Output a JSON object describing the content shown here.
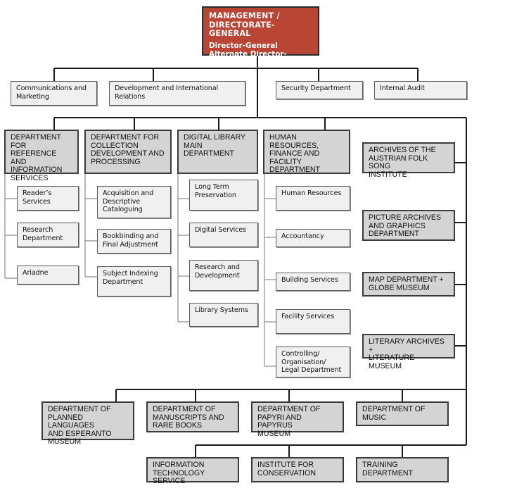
{
  "colors": {
    "management_fill": "#b94535",
    "department_fill": "#d4d4d4",
    "unit_fill": "#f0f0f0",
    "line": "#1a1a1a"
  },
  "management": {
    "title_lines": [
      "MANAGEMENT /",
      "DIRECTORATE-GENERAL"
    ],
    "roles": [
      "Director-General",
      "Alternate Director-General"
    ]
  },
  "staff_units": [
    {
      "label_lines": [
        "Communications and",
        "Marketing"
      ]
    },
    {
      "label_lines": [
        "Development and International",
        "Relations"
      ]
    },
    {
      "label_lines": [
        "Security Department"
      ]
    },
    {
      "label_lines": [
        "Internal Audit"
      ]
    }
  ],
  "main_departments": [
    {
      "label_lines": [
        "DEPARTMENT FOR",
        "REFERENCE AND",
        "INFORMATION",
        "SERVICES"
      ],
      "units": [
        {
          "label_lines": [
            "Reader’s",
            "Services"
          ]
        },
        {
          "label_lines": [
            "Research",
            "Department"
          ]
        },
        {
          "label_lines": [
            "Ariadne"
          ]
        }
      ]
    },
    {
      "label_lines": [
        "DEPARTMENT FOR",
        "COLLECTION",
        "DEVELOPMENT AND",
        "PROCESSING"
      ],
      "units": [
        {
          "label_lines": [
            "Acquisition and",
            "Descriptive",
            "Cataloguing"
          ]
        },
        {
          "label_lines": [
            "Bookbinding and",
            "Final Adjustment"
          ]
        },
        {
          "label_lines": [
            "Subject Indexing",
            "Department"
          ]
        }
      ]
    },
    {
      "label_lines": [
        "DIGITAL LIBRARY",
        "MAIN DEPARTMENT"
      ],
      "units": [
        {
          "label_lines": [
            "Long Term",
            "Preservation"
          ]
        },
        {
          "label_lines": [
            "Digital Services"
          ]
        },
        {
          "label_lines": [
            "Research and",
            "Development"
          ]
        },
        {
          "label_lines": [
            "Library Systems"
          ]
        }
      ]
    },
    {
      "label_lines": [
        "HUMAN RESOURCES,",
        "FINANCE AND",
        "FACILITY",
        "DEPARTMENT"
      ],
      "units": [
        {
          "label_lines": [
            "Human Resources"
          ]
        },
        {
          "label_lines": [
            "Accountancy"
          ]
        },
        {
          "label_lines": [
            "Building Services"
          ]
        },
        {
          "label_lines": [
            "Facility Services"
          ]
        },
        {
          "label_lines": [
            "Controlling/",
            "Organisation/",
            "Legal Department"
          ]
        }
      ]
    }
  ],
  "collection_departments": [
    {
      "label_lines": [
        "ARCHIVES OF THE",
        "AUSTRIAN FOLK SONG",
        "INSTITUTE"
      ]
    },
    {
      "label_lines": [
        "PICTURE ARCHIVES",
        "AND GRAPHICS",
        "DEPARTMENT"
      ]
    },
    {
      "label_lines": [
        "MAP DEPARTMENT +",
        "GLOBE MUSEUM"
      ]
    },
    {
      "label_lines": [
        "LITERARY ARCHIVES +",
        "LITERATURE MUSEUM"
      ]
    }
  ],
  "lower_departments": [
    {
      "label_lines": [
        "DEPARTMENT OF",
        "PLANNED LANGUAGES",
        "AND ESPERANTO",
        "MUSEUM"
      ]
    },
    {
      "label_lines": [
        "DEPARTMENT OF",
        "MANUSCRIPTS AND",
        "RARE BOOKS"
      ]
    },
    {
      "label_lines": [
        "DEPARTMENT OF",
        "PAPYRI AND PAPYRUS",
        "MUSEUM"
      ]
    },
    {
      "label_lines": [
        "DEPARTMENT OF",
        "MUSIC"
      ]
    }
  ],
  "service_departments": [
    {
      "label_lines": [
        "INFORMATION",
        "TECHNOLOGY SERVICE"
      ]
    },
    {
      "label_lines": [
        "INSTITUTE FOR",
        "CONSERVATION"
      ]
    },
    {
      "label_lines": [
        "TRAINING",
        "DEPARTMENT"
      ]
    }
  ]
}
